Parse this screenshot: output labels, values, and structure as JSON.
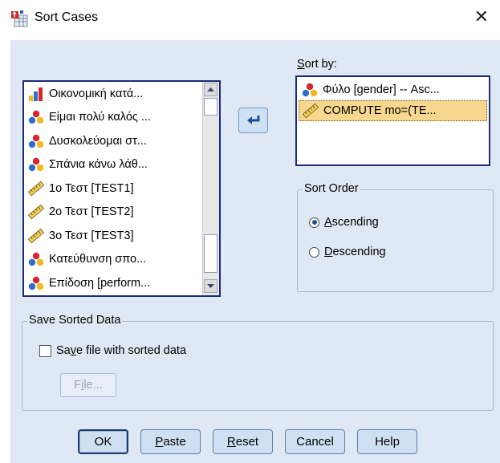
{
  "window": {
    "title": "Sort Cases",
    "close_glyph": "✕"
  },
  "source_list": {
    "items": [
      {
        "label": "Οικονομική κατά...",
        "icon": "ordinal-bar-icon"
      },
      {
        "label": "Είμαι πολύ καλός ...",
        "icon": "nominal-icon"
      },
      {
        "label": "Δυσκολεύομαι στ...",
        "icon": "nominal-icon"
      },
      {
        "label": "Σπάνια κάνω λάθ...",
        "icon": "nominal-icon"
      },
      {
        "label": "1ο Τεστ [TEST1]",
        "icon": "scale-ruler-icon"
      },
      {
        "label": "2ο Τεστ [TEST2]",
        "icon": "scale-ruler-icon"
      },
      {
        "label": "3ο Τεστ [TEST3]",
        "icon": "scale-ruler-icon"
      },
      {
        "label": "Κατεύθυνση σπο...",
        "icon": "nominal-icon"
      },
      {
        "label": "Επίδοση [perform...",
        "icon": "nominal-icon"
      }
    ]
  },
  "sort_by": {
    "label_prefix": "",
    "label_underlined": "S",
    "label_rest": "ort by:",
    "items": [
      {
        "label": "Φύλο [gender] -- Asc...",
        "icon": "nominal-icon",
        "selected": false
      },
      {
        "label": "COMPUTE mo=(TE...",
        "icon": "scale-ruler-icon",
        "selected": true
      }
    ]
  },
  "sort_order": {
    "title": "Sort Order",
    "options": [
      {
        "u": "A",
        "rest": "scending",
        "checked": true
      },
      {
        "u": "D",
        "rest": "escending",
        "checked": false
      }
    ]
  },
  "save_sorted": {
    "title": "Save Sorted Data",
    "checkbox_pre": "Sa",
    "checkbox_u": "v",
    "checkbox_post": "e file with sorted data",
    "checked": false,
    "file_btn_pre": "F",
    "file_btn_u": "i",
    "file_btn_post": "le..."
  },
  "buttons": {
    "ok": "OK",
    "paste_u": "P",
    "paste_rest": "aste",
    "reset_u": "R",
    "reset_rest": "eset",
    "cancel": "Cancel",
    "help": "Help"
  },
  "colors": {
    "accent_border": "#1d2a7a",
    "selection": "#f8d88e",
    "panel_bg": "#dfe9f5"
  }
}
